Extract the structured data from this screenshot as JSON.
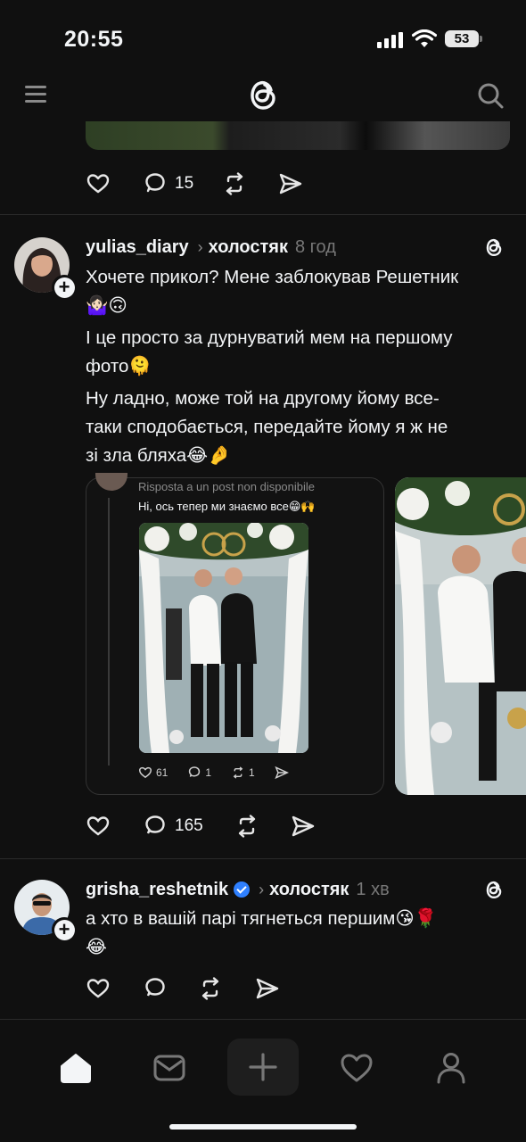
{
  "status_bar": {
    "time": "20:55",
    "battery": "53"
  },
  "header": {
    "logo_icon": "threads-logo-icon",
    "menu_icon": "hamburger-icon",
    "search_icon": "search-icon"
  },
  "previous_post": {
    "replies_count": "15"
  },
  "posts": [
    {
      "username": "yulias_diary",
      "community": "холостяк",
      "time": "8 год",
      "lines": [
        "Хочете прикол? Мене заблокував Решетник",
        "🤷🏻‍♀️🙃",
        "І це просто за дурнуватий мем на першому",
        "фото🫠",
        "Ну ладно, може той на другому йому все-",
        "таки сподобається, передайте йому я ж не",
        "зі зла бляха😂🤌"
      ],
      "embed": {
        "caption": "Risposta a un post non disponibile",
        "text": "Ні, ось тепер ми знаємо все😁🙌",
        "likes": "61",
        "replies": "1",
        "reposts": "1"
      },
      "replies_count": "165"
    },
    {
      "username": "grisha_reshetnik",
      "verified": true,
      "community": "холостяк",
      "time": "1 хв",
      "lines": [
        "а хто в вашій парі тягнеться першим😘🌹",
        "😂"
      ]
    }
  ],
  "bottom_nav": [
    "home-icon",
    "inbox-icon",
    "create-icon",
    "activity-heart-icon",
    "profile-icon"
  ],
  "colors": {
    "background": "#101010",
    "text": "#f3f5f7",
    "muted": "#777777",
    "verified": "#2f80ff"
  }
}
